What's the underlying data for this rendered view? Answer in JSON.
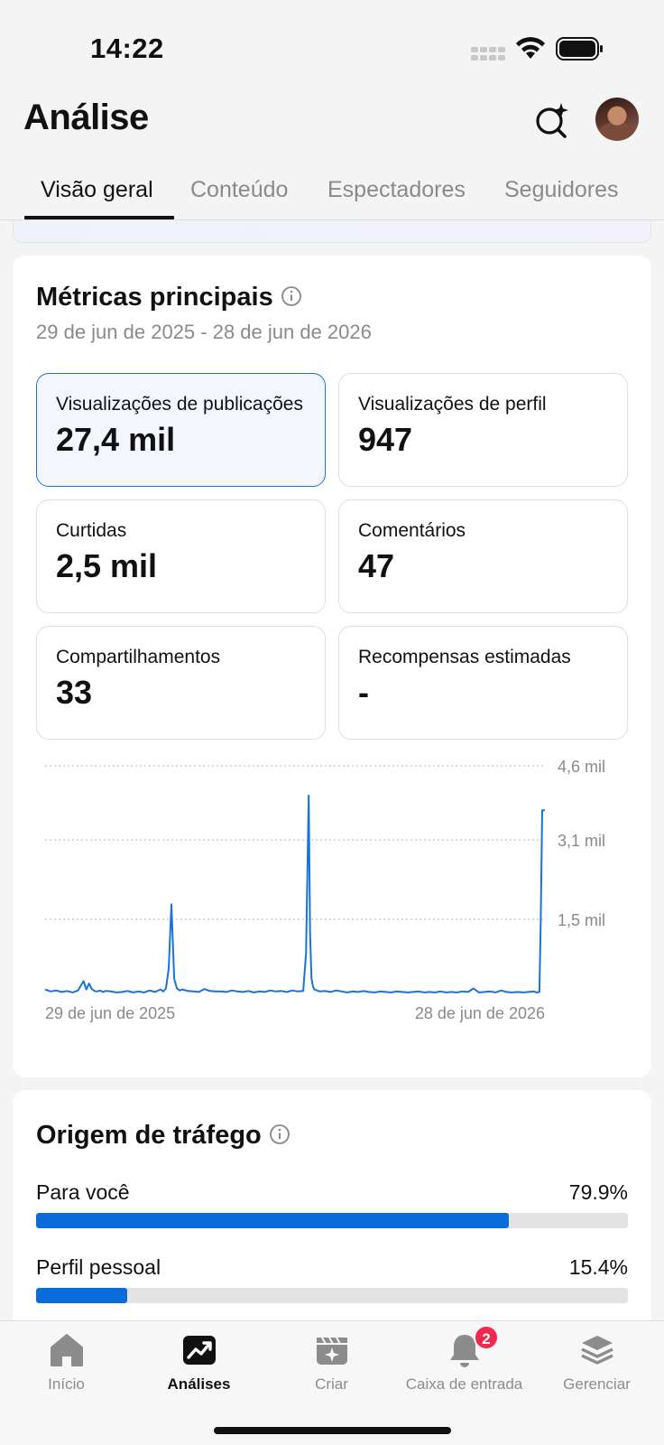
{
  "status_bar": {
    "time": "14:22"
  },
  "header": {
    "title": "Análise",
    "ai_search_icon": "sparkle-search-icon",
    "avatar_icon": "profile-avatar"
  },
  "tabs": [
    {
      "label": "Visão geral",
      "active": true
    },
    {
      "label": "Conteúdo",
      "active": false
    },
    {
      "label": "Espectadores",
      "active": false
    },
    {
      "label": "Seguidores",
      "active": false
    }
  ],
  "metrics": {
    "title": "Métricas principais",
    "date_range": "29 de jun de 2025 - 28 de jun de 2026",
    "cards": [
      {
        "label": "Visualizações de publicações",
        "value": "27,4 mil",
        "selected": true
      },
      {
        "label": "Visualizações de perfil",
        "value": "947",
        "selected": false
      },
      {
        "label": "Curtidas",
        "value": "2,5 mil",
        "selected": false
      },
      {
        "label": "Comentários",
        "value": "47",
        "selected": false
      },
      {
        "label": "Compartilhamentos",
        "value": "33",
        "selected": false
      },
      {
        "label": "Recompensas estimadas",
        "value": "-",
        "selected": false
      }
    ]
  },
  "chart_data": {
    "type": "line",
    "color": "#1a73d9",
    "grid": true,
    "y_tick_labels": [
      "4,6 mil",
      "3,1 mil",
      "1,5 mil"
    ],
    "y_ticks": [
      4600,
      3100,
      1500
    ],
    "ylim": [
      0,
      4600
    ],
    "x_tick_labels": [
      "29 de jun de 2025",
      "28 de jun de 2026"
    ],
    "x_range_days": [
      0,
      364
    ],
    "series": [
      {
        "x": [
          0,
          4,
          8,
          12,
          16,
          20,
          24,
          28,
          30,
          32,
          34,
          36,
          38,
          40,
          42,
          44,
          48,
          52,
          56,
          60,
          64,
          68,
          72,
          76,
          80,
          84,
          86,
          88,
          90,
          92,
          94,
          96,
          98,
          100,
          104,
          108,
          112,
          116,
          120,
          124,
          128,
          132,
          136,
          140,
          144,
          148,
          152,
          156,
          160,
          164,
          168,
          172,
          176,
          180,
          184,
          188,
          190,
          192,
          193,
          194,
          195,
          196,
          198,
          200,
          204,
          208,
          212,
          216,
          220,
          224,
          228,
          232,
          236,
          240,
          244,
          248,
          252,
          256,
          260,
          264,
          268,
          272,
          276,
          280,
          284,
          288,
          292,
          296,
          300,
          304,
          308,
          312,
          316,
          320,
          324,
          328,
          332,
          336,
          340,
          344,
          348,
          352,
          356,
          358,
          360,
          361,
          362,
          364
        ],
        "y": [
          80,
          40,
          60,
          30,
          50,
          20,
          60,
          250,
          80,
          200,
          90,
          50,
          40,
          60,
          30,
          50,
          40,
          20,
          30,
          50,
          20,
          40,
          20,
          60,
          30,
          80,
          40,
          100,
          500,
          1800,
          300,
          100,
          60,
          80,
          50,
          40,
          30,
          90,
          50,
          40,
          40,
          30,
          60,
          40,
          30,
          50,
          20,
          40,
          30,
          60,
          40,
          50,
          30,
          60,
          40,
          50,
          800,
          4000,
          1200,
          300,
          150,
          80,
          60,
          40,
          50,
          30,
          60,
          40,
          20,
          40,
          30,
          50,
          30,
          20,
          40,
          30,
          20,
          40,
          30,
          20,
          30,
          40,
          20,
          30,
          20,
          40,
          20,
          30,
          20,
          40,
          30,
          100,
          20,
          30,
          40,
          20,
          60,
          30,
          20,
          30,
          20,
          30,
          40,
          20,
          30,
          1500,
          3700,
          3700
        ]
      }
    ]
  },
  "traffic": {
    "title": "Origem de tráfego",
    "rows": [
      {
        "label": "Para você",
        "percent_label": "79.9%",
        "percent": 79.9
      },
      {
        "label": "Perfil pessoal",
        "percent_label": "15.4%",
        "percent": 15.4
      }
    ]
  },
  "bottom_nav": [
    {
      "label": "Início",
      "icon": "home-icon",
      "active": false
    },
    {
      "label": "Análises",
      "icon": "analytics-icon",
      "active": true
    },
    {
      "label": "Criar",
      "icon": "create-icon",
      "active": false
    },
    {
      "label": "Caixa de entrada",
      "icon": "bell-icon",
      "active": false,
      "badge": "2"
    },
    {
      "label": "Gerenciar",
      "icon": "layers-icon",
      "active": false
    }
  ]
}
